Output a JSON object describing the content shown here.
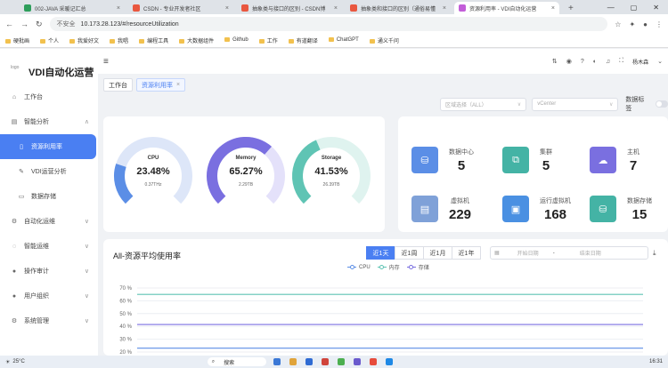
{
  "browser": {
    "tabs": [
      {
        "title": "002-JAVA 采暖记汇总",
        "color": "#2e9e5b"
      },
      {
        "title": "CSDN - 专业开发者社区",
        "color": "#e9573f"
      },
      {
        "title": "抽象类与接口的区别 - CSDN博",
        "color": "#e9573f"
      },
      {
        "title": "抽象类和接口的区别（通俗易懂",
        "color": "#e9573f"
      },
      {
        "title": "资源利用率 - VDI自动化运营",
        "color": "#c25dd8"
      }
    ],
    "url_warning": "不安全",
    "url": "10.173.28.123/#/resourceUtilization",
    "bookmarks": [
      "硬批画",
      "个人",
      "我爱好文",
      "我唱",
      "编程工具",
      "大数据组件",
      "Github",
      "工作",
      "有道翻译",
      "ChatGPT",
      "通义千问"
    ]
  },
  "app": {
    "logo_alt": "logo",
    "title": "VDI自动化运营",
    "user": "杨木森"
  },
  "sidebar": {
    "items": [
      {
        "label": "工作台",
        "icon": "home-icon",
        "glyph": "⌂",
        "arrow": ""
      },
      {
        "label": "智能分析",
        "icon": "analysis-icon",
        "glyph": "▤",
        "arrow": "∧"
      },
      {
        "label": "资源利用率",
        "icon": "doc-icon",
        "glyph": "▯",
        "arrow": "",
        "active": true,
        "sub": true
      },
      {
        "label": "VDI运营分析",
        "icon": "wrench-icon",
        "glyph": "✎",
        "arrow": "",
        "sub": true
      },
      {
        "label": "数据存储",
        "icon": "storage-icon",
        "glyph": "▭",
        "arrow": "",
        "sub": true
      },
      {
        "label": "自动化运维",
        "icon": "gear-icon",
        "glyph": "⚙",
        "arrow": "∨"
      },
      {
        "label": "智能运维",
        "icon": "settings-icon",
        "glyph": "◌",
        "arrow": "∨"
      },
      {
        "label": "操作审计",
        "icon": "user-icon",
        "glyph": "●",
        "arrow": "∨"
      },
      {
        "label": "用户组织",
        "icon": "users-icon",
        "glyph": "●",
        "arrow": "∨"
      },
      {
        "label": "系统管理",
        "icon": "cogs-icon",
        "glyph": "⚙",
        "arrow": "∨"
      }
    ]
  },
  "tags": [
    {
      "label": "工作台",
      "active": false
    },
    {
      "label": "资源利用率",
      "active": true
    }
  ],
  "filters": {
    "region_placeholder": "区域选择（ALL）",
    "vcenter_placeholder": "vCenter",
    "data_tag_label": "数据标签"
  },
  "gauges": [
    {
      "name": "CPU",
      "percent": 23.48,
      "percent_label": "23.48%",
      "sub": "0.37THz",
      "color": "#5b8ee6",
      "track": "#dde6f8"
    },
    {
      "name": "Memory",
      "percent": 65.27,
      "percent_label": "65.27%",
      "sub": "2.29TB",
      "color": "#7a6fe0",
      "track": "#e4e1fa"
    },
    {
      "name": "Storage",
      "percent": 41.53,
      "percent_label": "41.53%",
      "sub": "26.39TB",
      "color": "#5fc4b4",
      "track": "#dff3ef"
    }
  ],
  "stats": [
    {
      "name": "数据中心",
      "value": "5",
      "icon": "database-icon",
      "glyph": "⛁",
      "color": "#5b8ee6"
    },
    {
      "name": "集群",
      "value": "5",
      "icon": "cluster-icon",
      "glyph": "⧉",
      "color": "#44b3a5"
    },
    {
      "name": "主机",
      "value": "7",
      "icon": "cloud-icon",
      "glyph": "☁",
      "color": "#7a6fe0"
    },
    {
      "name": "虚拟机",
      "value": "229",
      "icon": "server-icon",
      "glyph": "▤",
      "color": "#7fa1d8"
    },
    {
      "name": "运行虚拟机",
      "value": "168",
      "icon": "monitor-icon",
      "glyph": "▣",
      "color": "#4a90e2"
    },
    {
      "name": "数据存储",
      "value": "15",
      "icon": "db-stack-icon",
      "glyph": "⛁",
      "color": "#44b3a5"
    }
  ],
  "usage_chart": {
    "title": "All-资源平均使用率",
    "ranges": [
      "近1天",
      "近1周",
      "近1月",
      "近1年"
    ],
    "active_range": 0,
    "start_placeholder": "开始日期",
    "end_placeholder": "结束日期",
    "date_separator": "-"
  },
  "chart_data": {
    "type": "line",
    "title": "",
    "xlabel": "",
    "ylabel": "",
    "y_ticks": [
      "70 %",
      "60 %",
      "50 %",
      "40 %",
      "30 %",
      "20 %"
    ],
    "ylim": [
      20,
      70
    ],
    "grid": true,
    "legend": "top-center",
    "series": [
      {
        "name": "CPU",
        "color": "#5b8ee6",
        "values": [
          23,
          23,
          23,
          23,
          23,
          23
        ]
      },
      {
        "name": "内存",
        "color": "#5fc4b4",
        "values": [
          65,
          65,
          65,
          65,
          65,
          65
        ]
      },
      {
        "name": "存储",
        "color": "#7a6fe0",
        "values": [
          41.5,
          41.5,
          41.5,
          41.5,
          41.5,
          41.5
        ]
      }
    ]
  },
  "taskbar": {
    "weather": "25°C",
    "search": "搜索",
    "time": "16:31"
  }
}
